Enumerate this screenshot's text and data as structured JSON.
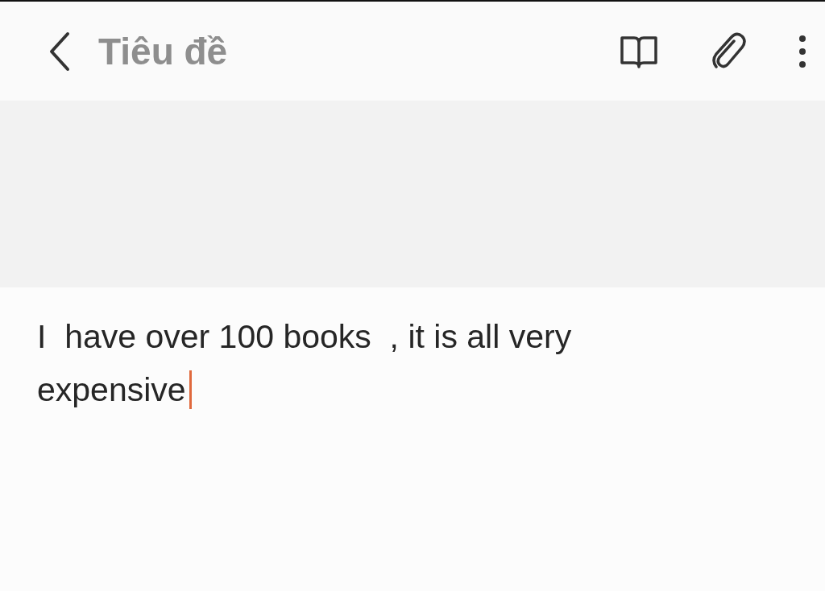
{
  "header": {
    "title": {
      "placeholder": "Tiêu đề"
    }
  },
  "body": {
    "text": "I  have over 100 books  , it is all very expensive",
    "focused": true
  }
}
